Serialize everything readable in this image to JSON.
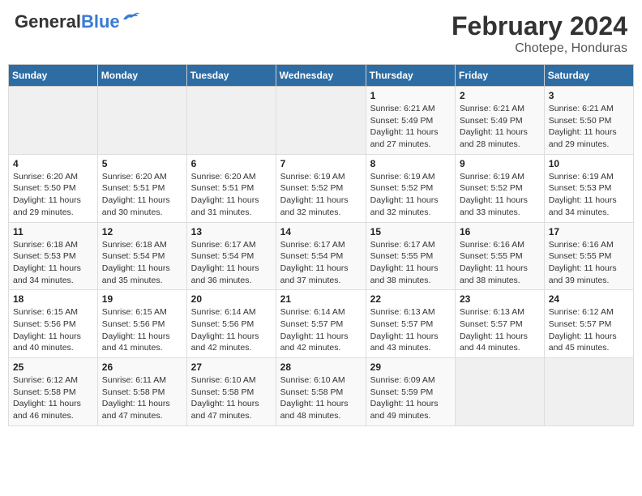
{
  "header": {
    "logo_general": "General",
    "logo_blue": "Blue",
    "title": "February 2024",
    "subtitle": "Chotepe, Honduras"
  },
  "calendar": {
    "weekdays": [
      "Sunday",
      "Monday",
      "Tuesday",
      "Wednesday",
      "Thursday",
      "Friday",
      "Saturday"
    ],
    "weeks": [
      [
        {
          "day": "",
          "info": ""
        },
        {
          "day": "",
          "info": ""
        },
        {
          "day": "",
          "info": ""
        },
        {
          "day": "",
          "info": ""
        },
        {
          "day": "1",
          "info": "Sunrise: 6:21 AM\nSunset: 5:49 PM\nDaylight: 11 hours and 27 minutes."
        },
        {
          "day": "2",
          "info": "Sunrise: 6:21 AM\nSunset: 5:49 PM\nDaylight: 11 hours and 28 minutes."
        },
        {
          "day": "3",
          "info": "Sunrise: 6:21 AM\nSunset: 5:50 PM\nDaylight: 11 hours and 29 minutes."
        }
      ],
      [
        {
          "day": "4",
          "info": "Sunrise: 6:20 AM\nSunset: 5:50 PM\nDaylight: 11 hours and 29 minutes."
        },
        {
          "day": "5",
          "info": "Sunrise: 6:20 AM\nSunset: 5:51 PM\nDaylight: 11 hours and 30 minutes."
        },
        {
          "day": "6",
          "info": "Sunrise: 6:20 AM\nSunset: 5:51 PM\nDaylight: 11 hours and 31 minutes."
        },
        {
          "day": "7",
          "info": "Sunrise: 6:19 AM\nSunset: 5:52 PM\nDaylight: 11 hours and 32 minutes."
        },
        {
          "day": "8",
          "info": "Sunrise: 6:19 AM\nSunset: 5:52 PM\nDaylight: 11 hours and 32 minutes."
        },
        {
          "day": "9",
          "info": "Sunrise: 6:19 AM\nSunset: 5:52 PM\nDaylight: 11 hours and 33 minutes."
        },
        {
          "day": "10",
          "info": "Sunrise: 6:19 AM\nSunset: 5:53 PM\nDaylight: 11 hours and 34 minutes."
        }
      ],
      [
        {
          "day": "11",
          "info": "Sunrise: 6:18 AM\nSunset: 5:53 PM\nDaylight: 11 hours and 34 minutes."
        },
        {
          "day": "12",
          "info": "Sunrise: 6:18 AM\nSunset: 5:54 PM\nDaylight: 11 hours and 35 minutes."
        },
        {
          "day": "13",
          "info": "Sunrise: 6:17 AM\nSunset: 5:54 PM\nDaylight: 11 hours and 36 minutes."
        },
        {
          "day": "14",
          "info": "Sunrise: 6:17 AM\nSunset: 5:54 PM\nDaylight: 11 hours and 37 minutes."
        },
        {
          "day": "15",
          "info": "Sunrise: 6:17 AM\nSunset: 5:55 PM\nDaylight: 11 hours and 38 minutes."
        },
        {
          "day": "16",
          "info": "Sunrise: 6:16 AM\nSunset: 5:55 PM\nDaylight: 11 hours and 38 minutes."
        },
        {
          "day": "17",
          "info": "Sunrise: 6:16 AM\nSunset: 5:55 PM\nDaylight: 11 hours and 39 minutes."
        }
      ],
      [
        {
          "day": "18",
          "info": "Sunrise: 6:15 AM\nSunset: 5:56 PM\nDaylight: 11 hours and 40 minutes."
        },
        {
          "day": "19",
          "info": "Sunrise: 6:15 AM\nSunset: 5:56 PM\nDaylight: 11 hours and 41 minutes."
        },
        {
          "day": "20",
          "info": "Sunrise: 6:14 AM\nSunset: 5:56 PM\nDaylight: 11 hours and 42 minutes."
        },
        {
          "day": "21",
          "info": "Sunrise: 6:14 AM\nSunset: 5:57 PM\nDaylight: 11 hours and 42 minutes."
        },
        {
          "day": "22",
          "info": "Sunrise: 6:13 AM\nSunset: 5:57 PM\nDaylight: 11 hours and 43 minutes."
        },
        {
          "day": "23",
          "info": "Sunrise: 6:13 AM\nSunset: 5:57 PM\nDaylight: 11 hours and 44 minutes."
        },
        {
          "day": "24",
          "info": "Sunrise: 6:12 AM\nSunset: 5:57 PM\nDaylight: 11 hours and 45 minutes."
        }
      ],
      [
        {
          "day": "25",
          "info": "Sunrise: 6:12 AM\nSunset: 5:58 PM\nDaylight: 11 hours and 46 minutes."
        },
        {
          "day": "26",
          "info": "Sunrise: 6:11 AM\nSunset: 5:58 PM\nDaylight: 11 hours and 47 minutes."
        },
        {
          "day": "27",
          "info": "Sunrise: 6:10 AM\nSunset: 5:58 PM\nDaylight: 11 hours and 47 minutes."
        },
        {
          "day": "28",
          "info": "Sunrise: 6:10 AM\nSunset: 5:58 PM\nDaylight: 11 hours and 48 minutes."
        },
        {
          "day": "29",
          "info": "Sunrise: 6:09 AM\nSunset: 5:59 PM\nDaylight: 11 hours and 49 minutes."
        },
        {
          "day": "",
          "info": ""
        },
        {
          "day": "",
          "info": ""
        }
      ]
    ]
  }
}
